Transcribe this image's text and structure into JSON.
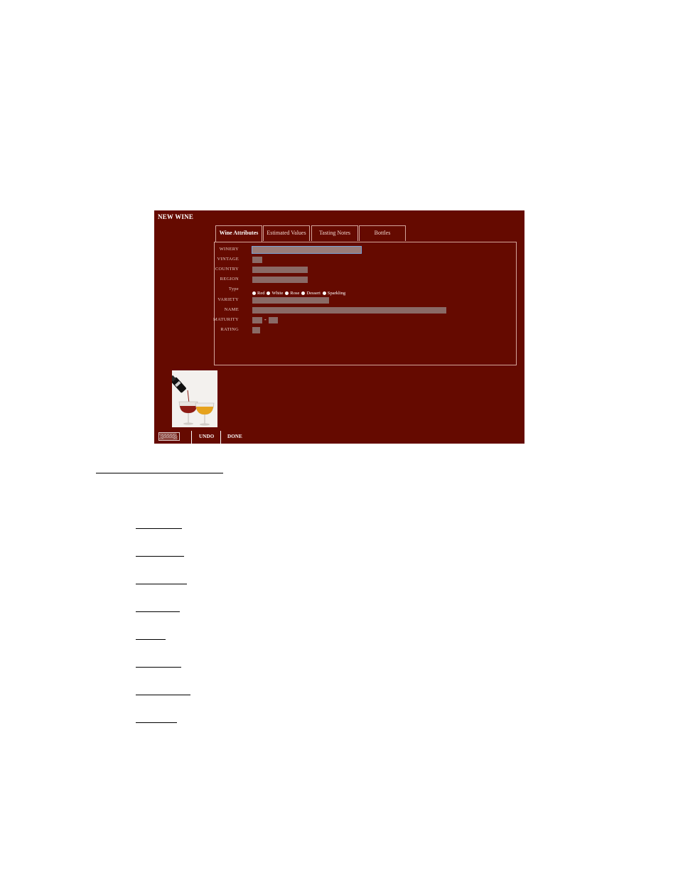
{
  "window": {
    "title": "NEW WINE"
  },
  "tabs": [
    {
      "label": "Wine Attributes",
      "active": true
    },
    {
      "label": "Estimated Values",
      "active": false
    },
    {
      "label": "Tasting Notes",
      "active": false
    },
    {
      "label": "Bottles",
      "active": false
    }
  ],
  "form": {
    "winery": {
      "label": "WINERY",
      "value": ""
    },
    "vintage": {
      "label": "VINTAGE",
      "value": ""
    },
    "country": {
      "label": "COUNTRY",
      "value": ""
    },
    "region": {
      "label": "REGION",
      "value": ""
    },
    "type": {
      "label": "Type",
      "options": [
        "Red",
        "White",
        "Rose",
        "Dessert",
        "Sparkling"
      ]
    },
    "variety": {
      "label": "VARIETY",
      "value": ""
    },
    "name": {
      "label": "NAME",
      "value": ""
    },
    "maturity": {
      "label": "MATURITY",
      "from": "",
      "to": "",
      "separator": "-"
    },
    "rating": {
      "label": "RATING",
      "value": ""
    }
  },
  "toolbar": {
    "undo_label": "UNDO",
    "done_label": "DONE",
    "keyboard_icon": "keyboard-icon"
  },
  "colors": {
    "background": "#650a00",
    "field": "#8a6a66",
    "focus_ring": "#7aa4d6",
    "border": "#d4a59b"
  }
}
